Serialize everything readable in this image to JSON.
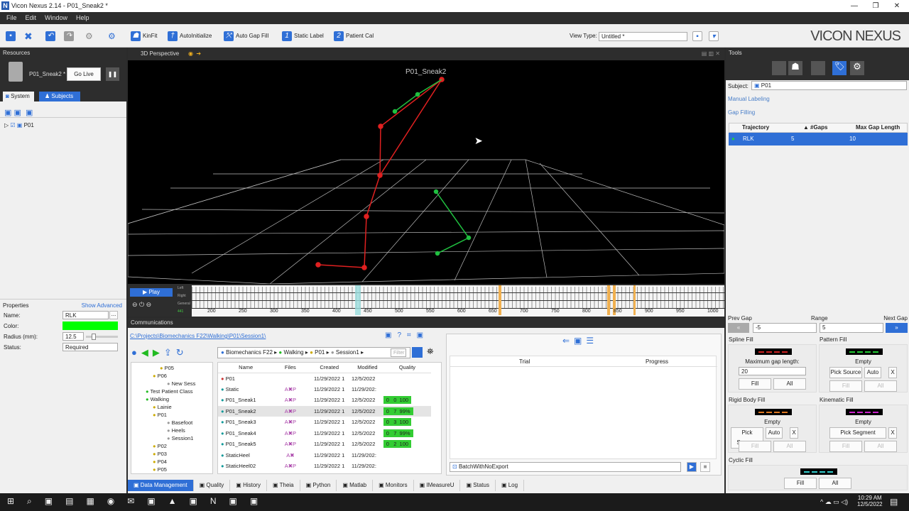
{
  "window": {
    "title": "Vicon Nexus 2.14 - P01_Sneak2 *",
    "app_icon": "N"
  },
  "menu": [
    "File",
    "Edit",
    "Window",
    "Help"
  ],
  "toolbar": {
    "buttons": [
      "KinFit",
      "AutoInitialize",
      "Auto Gap Fill",
      "Static Label",
      "Patient Cal"
    ],
    "view_type_label": "View Type:",
    "view_type_value": "Untitled *",
    "logo": "VICON NEXUS"
  },
  "resources": {
    "title": "Resources",
    "trial": "P01_Sneak2 *",
    "go_live": "Go Live",
    "tabs": [
      "System",
      "Subjects"
    ],
    "tree": [
      "P01"
    ]
  },
  "properties": {
    "title": "Properties",
    "show_advanced": "Show Advanced",
    "name_label": "Name:",
    "name_value": "RLK",
    "color_label": "Color:",
    "color_value": "#00ff00",
    "radius_label": "Radius (mm):",
    "radius_value": "12.5",
    "radius_fraction": 0.2,
    "status_label": "Status:",
    "status_value": "Required"
  },
  "view": {
    "title": "3D Perspective",
    "trial_label": "P01_Sneak2"
  },
  "timeline": {
    "play": "Play",
    "rows": [
      "Left",
      "Right",
      "General"
    ],
    "frame": "441",
    "ticks": [
      "200",
      "250",
      "300",
      "350",
      "400",
      "450",
      "500",
      "550",
      "600",
      "650",
      "700",
      "750",
      "800",
      "850",
      "900",
      "950",
      "1000"
    ]
  },
  "communications": {
    "title": "Communications",
    "path": "C:\\Projects\\Biomechanics F22\\Walking\\P01\\Session1\\",
    "breadcrumb": [
      "Biomechanics F22",
      "Walking",
      "P01",
      "Session1"
    ],
    "filter_placeholder": "Filter",
    "tree": [
      "P05",
      "P06",
      "New Sess",
      "Test Patient Class",
      "Walking",
      "Lainie",
      "P01",
      "Basefoot",
      "Heels",
      "Session1",
      "P02",
      "P03",
      "P04",
      "P05"
    ],
    "columns": [
      "Name",
      "Files",
      "Created",
      "Modified",
      "Quality"
    ],
    "rows": [
      {
        "name": "P01",
        "files": "",
        "created": "11/29/2022 1",
        "modified": "12/5/2022",
        "q": ""
      },
      {
        "name": "Static",
        "files": "A✖P",
        "created": "11/29/2022 1",
        "modified": "11/29/202:",
        "q": ""
      },
      {
        "name": "P01_Sneak1",
        "files": "A✖P",
        "created": "11/29/2022 1",
        "modified": "12/5/2022",
        "q": "0   0  100"
      },
      {
        "name": "P01_Sneak2",
        "files": "A✖P",
        "created": "11/29/2022 1",
        "modified": "12/5/2022",
        "q": "0   7  99%"
      },
      {
        "name": "P01_Sneak3",
        "files": "A✖P",
        "created": "11/29/2022 1",
        "modified": "12/5/2022",
        "q": "0   3  100"
      },
      {
        "name": "P01_Sneak4",
        "files": "A✖P",
        "created": "11/29/2022 1",
        "modified": "12/5/2022",
        "q": "0   7  99%"
      },
      {
        "name": "P01_Sneak5",
        "files": "A✖P",
        "created": "11/29/2022 1",
        "modified": "12/5/2022",
        "q": "0   2  100"
      },
      {
        "name": "StaticHeel",
        "files": "A✖",
        "created": "11/29/2022 1",
        "modified": "11/29/202:",
        "q": ""
      },
      {
        "name": "StaticHeel02",
        "files": "A✖P",
        "created": "11/29/2022 1",
        "modified": "11/29/202:",
        "q": ""
      }
    ],
    "batch_columns": [
      "Trial",
      "Progress"
    ],
    "pipeline": "BatchWithNoExport",
    "tabs": [
      "Data Management",
      "Quality",
      "History",
      "Theia",
      "Python",
      "Matlab",
      "Monitors",
      "IMeasureU",
      "Status",
      "Log"
    ]
  },
  "tools": {
    "title": "Tools",
    "subject_label": "Subject:",
    "subject": "P01",
    "manual_labeling": "Manual Labeling",
    "gap_filling": "Gap Filling",
    "columns": [
      "Trajectory",
      "#Gaps",
      "Max Gap Length"
    ],
    "row": {
      "trajectory": "RLK",
      "gaps": "5",
      "max": "10"
    },
    "prev_gap": "Prev Gap",
    "range": "Range",
    "next_gap": "Next Gap",
    "range_from": "-5",
    "range_to": "5",
    "spline": {
      "title": "Spline Fill",
      "max_label": "Maximum gap length:",
      "max_value": "20",
      "fill": "Fill",
      "all": "All"
    },
    "pattern": {
      "title": "Pattern Fill",
      "status": "Empty",
      "pick": "Pick Source",
      "auto": "Auto",
      "fill": "Fill",
      "all": "All"
    },
    "rigid": {
      "title": "Rigid Body Fill",
      "status": "Empty",
      "pick": "Pick Sources",
      "auto": "Auto",
      "fill": "Fill",
      "all": "All"
    },
    "kinematic": {
      "title": "Kinematic Fill",
      "status": "Empty",
      "pick": "Pick Segment",
      "fill": "Fill",
      "all": "All"
    },
    "cyclic": {
      "title": "Cyclic Fill",
      "fill": "Fill",
      "all": "All"
    },
    "colors": {
      "spline": "#cc2222",
      "pattern": "#22cc33",
      "rigid": "#dd7722",
      "kinematic": "#cc22cc",
      "cyclic": "#33cccc"
    }
  },
  "taskbar": {
    "time": "10:29 AM",
    "date": "12/5/2022"
  }
}
